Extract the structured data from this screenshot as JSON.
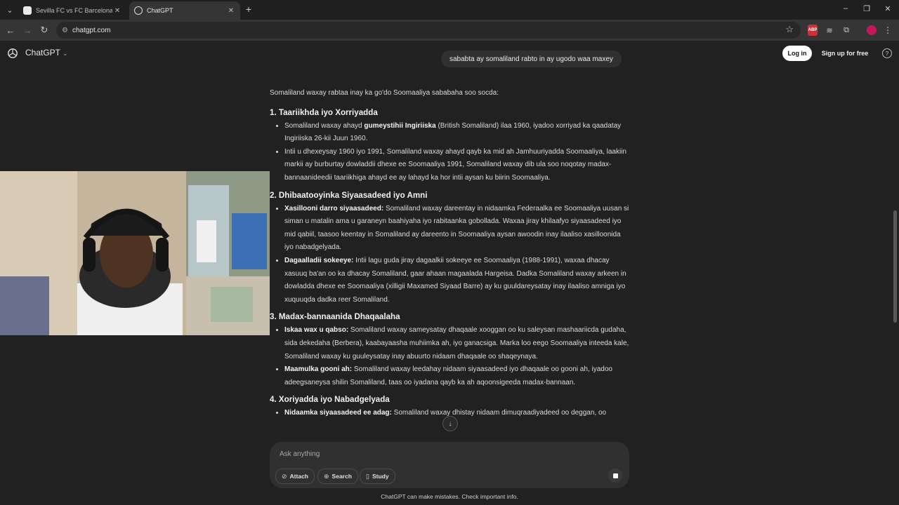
{
  "browser": {
    "tabs": [
      {
        "title": "Sevilla FC vs FC Barcelona Head",
        "active": false
      },
      {
        "title": "ChatGPT",
        "active": true
      }
    ],
    "url": "chatgpt.com"
  },
  "header": {
    "brand": "ChatGPT",
    "login_label": "Log in",
    "signup_label": "Sign up for free",
    "help_label": "?"
  },
  "user_message": "sababta ay somaliland rabto in ay ugodo waa maxey",
  "response": {
    "intro": "Somaliland waxay rabtaa inay ka go'do Soomaaliya sababaha soo socda:",
    "sections": [
      {
        "heading": "1. Taariikhda iyo Xorriyadda",
        "items": [
          {
            "lead": "",
            "pre": "Somaliland waxay ahayd ",
            "bold": "gumeystihii Ingiriiska",
            "post": " (British Somaliland) ilaa 1960, iyadoo xorriyad ka qaadatay Ingiriiska 26-kii Juun 1960."
          },
          {
            "lead": "",
            "pre": "Intii u dhexeysay 1960 iyo 1991, Somaliland waxay ahayd qayb ka mid ah Jamhuuriyadda Soomaaliya, laakiin markii ay burburtay dowladdii dhexe ee Soomaaliya 1991, Somaliland waxay dib ula soo noqotay madax-bannaanideedii taariikhiga ahayd ee ay lahayd ka hor intii aysan ku biirin Soomaaliya.",
            "bold": "",
            "post": ""
          }
        ]
      },
      {
        "heading": "2. Dhibaatooyinka Siyaasadeed iyo Amni",
        "items": [
          {
            "lead": "Xasillooni darro siyaasadeed:",
            "pre": " Somaliland waxay dareentay in nidaamka Federaalka ee Soomaaliya uusan si siman u matalin ama u garaneyn baahiyaha iyo rabitaanka gobollada. Waxaa jiray khilaafyo siyaasadeed iyo mid qabiil, taasoo keentay in Somaliland ay dareento in Soomaaliya aysan awoodin inay ilaaliso xasilloonida iyo nabadgelyada.",
            "bold": "",
            "post": ""
          },
          {
            "lead": "Dagaalladii sokeeye:",
            "pre": " Intii lagu guda jiray dagaalkii sokeeye ee Soomaaliya (1988-1991), waxaa dhacay xasuuq ba'an oo ka dhacay Somaliland, gaar ahaan magaalada Hargeisa. Dadka Somaliland waxay arkeen in dowladda dhexe ee Soomaaliya (xilligii Maxamed Siyaad Barre) ay ku guuldareysatay inay ilaaliso amniga iyo xuquuqda dadka reer Somaliland.",
            "bold": "",
            "post": ""
          }
        ]
      },
      {
        "heading": "3. Madax-bannaanida Dhaqaalaha",
        "items": [
          {
            "lead": "Iskaa wax u qabso:",
            "pre": " Somaliland waxay sameysatay dhaqaale xooggan oo ku saleysan mashaariicda gudaha, sida dekedaha (Berbera), kaabayaasha muhiimka ah, iyo ganacsiga. Marka loo eego Soomaaliya inteeda kale, Somaliland waxay ku guuleysatay inay abuurto nidaam dhaqaale oo shaqeynaya.",
            "bold": "",
            "post": ""
          },
          {
            "lead": "Maamulka gooni ah:",
            "pre": " Somaliland waxay leedahay nidaam siyaasadeed iyo dhaqaale oo gooni ah, iyadoo adeegsaneysa shilin Somaliland, taas oo iyadana qayb ka ah aqoonsigeeda madax-bannaan.",
            "bold": "",
            "post": ""
          }
        ]
      },
      {
        "heading": "4. Xoriyadda iyo Nabadgelyada",
        "items": [
          {
            "lead": "Nidaamka siyaasadeed ee adag:",
            "pre": " Somaliland waxay dhistay nidaam dimuqraadiyadeed oo deggan, oo",
            "bold": "",
            "post": ""
          }
        ]
      }
    ]
  },
  "composer": {
    "placeholder": "Ask anything",
    "attach_label": "Attach",
    "search_label": "Search",
    "study_label": "Study"
  },
  "footer_note": "ChatGPT can make mistakes. Check important info.",
  "colors": {
    "background": "#212121",
    "chrome_toolbar": "#353535",
    "bubble": "#303030",
    "text": "#ececec"
  }
}
